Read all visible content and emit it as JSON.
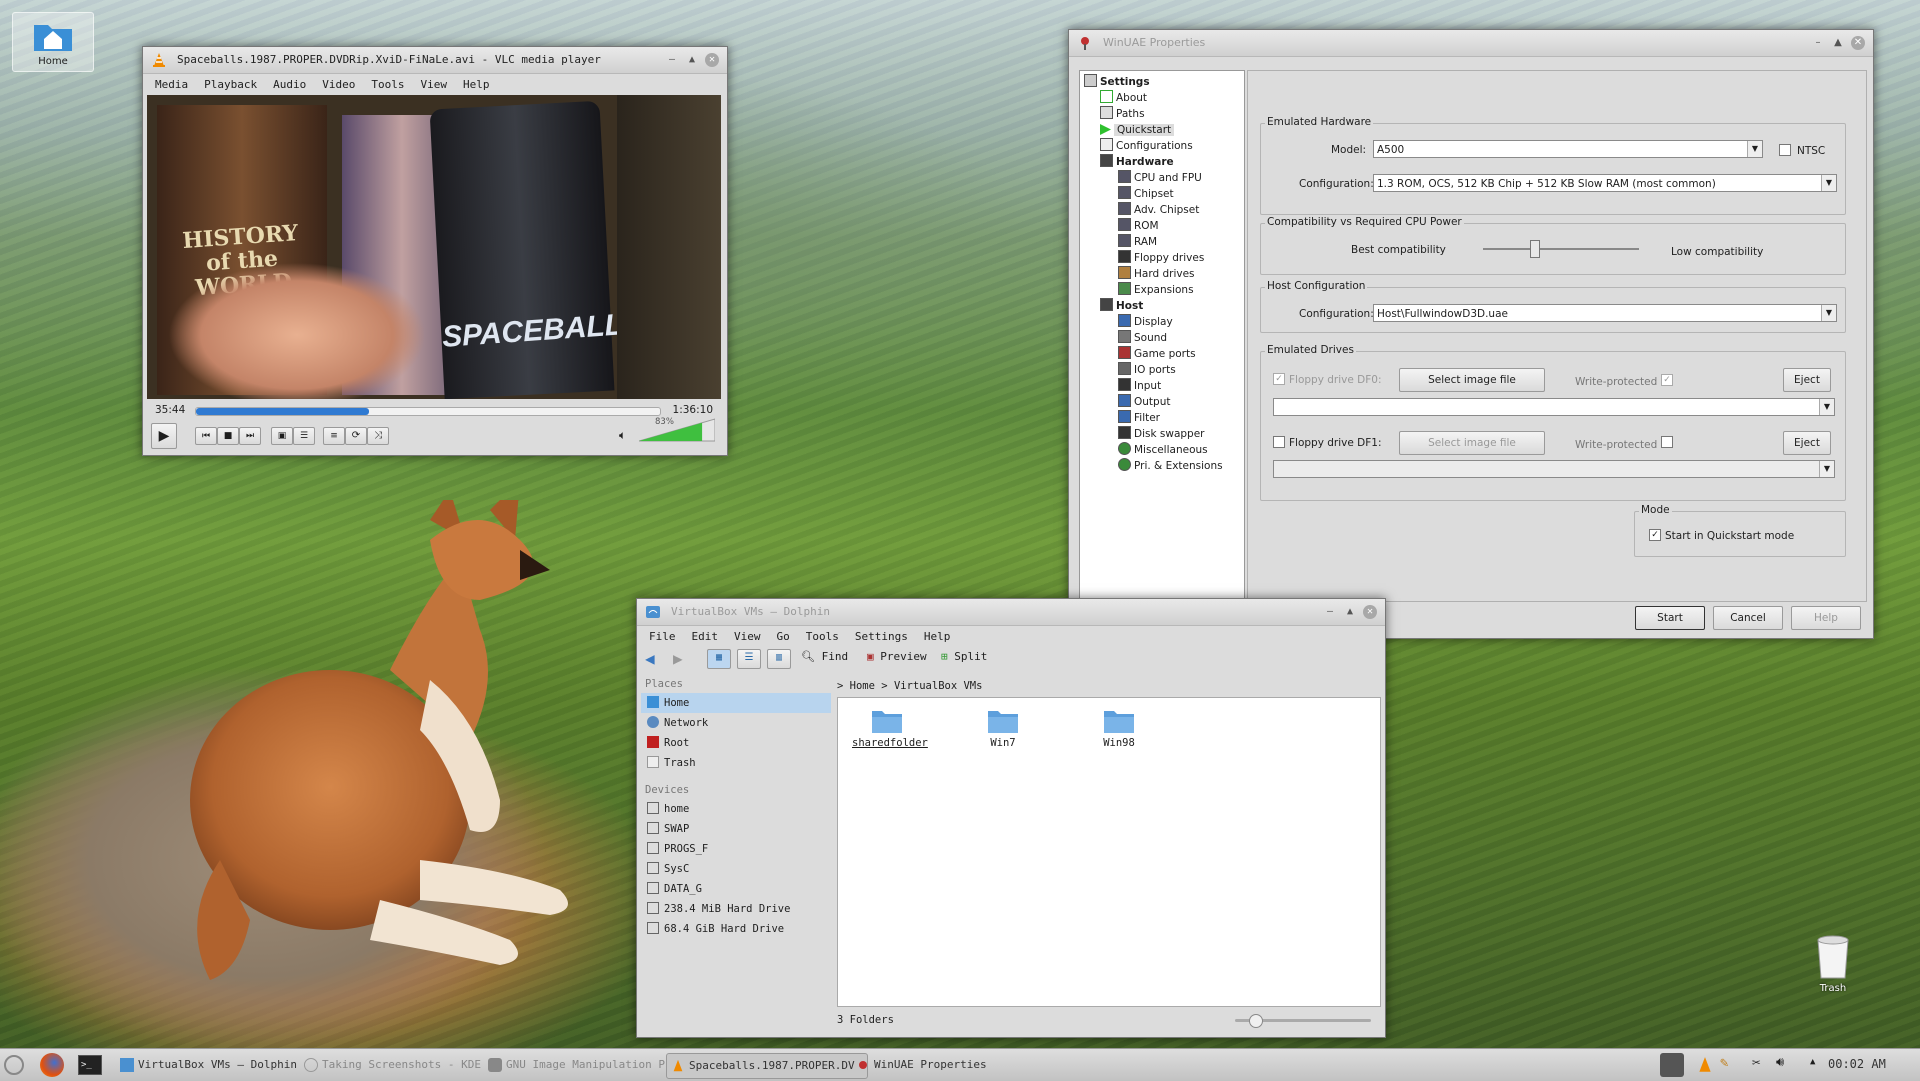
{
  "desktop": {
    "home_icon_label": "Home",
    "trash_icon_label": "Trash"
  },
  "vlc": {
    "title": "Spaceballs.1987.PROPER.DVDRip.XviD-FiNaLe.avi - VLC media player",
    "menu": [
      "Media",
      "Playback",
      "Audio",
      "Video",
      "Tools",
      "View",
      "Help"
    ],
    "elapsed": "35:44",
    "total": "1:36:10",
    "seek_fraction": 0.372,
    "volume_label": "83%",
    "volume_fraction": 0.83,
    "video_text_1": "HISTORY of the WORLD",
    "video_text_2": "SPACEBALLS"
  },
  "winuae": {
    "title": "WinUAE Properties",
    "tree": [
      {
        "label": "Settings",
        "level": 0,
        "bold": true
      },
      {
        "label": "About",
        "level": 1
      },
      {
        "label": "Paths",
        "level": 1
      },
      {
        "label": "Quickstart",
        "level": 1,
        "selected": true
      },
      {
        "label": "Configurations",
        "level": 1
      },
      {
        "label": "Hardware",
        "level": 1,
        "bold": true
      },
      {
        "label": "CPU and FPU",
        "level": 2
      },
      {
        "label": "Chipset",
        "level": 2
      },
      {
        "label": "Adv. Chipset",
        "level": 2
      },
      {
        "label": "ROM",
        "level": 2
      },
      {
        "label": "RAM",
        "level": 2
      },
      {
        "label": "Floppy drives",
        "level": 2
      },
      {
        "label": "Hard drives",
        "level": 2
      },
      {
        "label": "Expansions",
        "level": 2
      },
      {
        "label": "Host",
        "level": 1,
        "bold": true
      },
      {
        "label": "Display",
        "level": 2
      },
      {
        "label": "Sound",
        "level": 2
      },
      {
        "label": "Game ports",
        "level": 2
      },
      {
        "label": "IO ports",
        "level": 2
      },
      {
        "label": "Input",
        "level": 2
      },
      {
        "label": "Output",
        "level": 2
      },
      {
        "label": "Filter",
        "level": 2
      },
      {
        "label": "Disk swapper",
        "level": 2
      },
      {
        "label": "Miscellaneous",
        "level": 2
      },
      {
        "label": "Pri. & Extensions",
        "level": 2
      }
    ],
    "emulated_hardware": {
      "title": "Emulated Hardware",
      "model_label": "Model:",
      "model_value": "A500",
      "ntsc_label": "NTSC",
      "config_label": "Configuration:",
      "config_value": "1.3 ROM, OCS, 512 KB Chip + 512 KB Slow RAM (most common)"
    },
    "compat": {
      "title": "Compatibility vs Required CPU Power",
      "best": "Best compatibility",
      "low": "Low compatibility",
      "slider_fraction": 0.33
    },
    "host_config": {
      "title": "Host Configuration",
      "config_label": "Configuration:",
      "config_value": "Host\\FullwindowD3D.uae"
    },
    "drives": {
      "title": "Emulated Drives",
      "df0_label": "Floppy drive DF0:",
      "df1_label": "Floppy drive DF1:",
      "select_image": "Select image file",
      "write_protected": "Write-protected",
      "eject": "Eject"
    },
    "mode": {
      "title": "Mode",
      "quickstart_label": "Start in Quickstart mode"
    },
    "buttons": {
      "start": "Start",
      "cancel": "Cancel",
      "help": "Help"
    }
  },
  "dolphin": {
    "title": "VirtualBox VMs – Dolphin",
    "menu": [
      "File",
      "Edit",
      "View",
      "Go",
      "Tools",
      "Settings",
      "Help"
    ],
    "toolbar": {
      "find": "Find",
      "preview": "Preview",
      "split": "Split"
    },
    "places_header": "Places",
    "places": [
      {
        "label": "Home",
        "icon": "home-icon",
        "selected": true
      },
      {
        "label": "Network",
        "icon": "network-icon"
      },
      {
        "label": "Root",
        "icon": "root-icon"
      },
      {
        "label": "Trash",
        "icon": "trash-icon"
      }
    ],
    "devices_header": "Devices",
    "devices": [
      "home",
      "SWAP",
      "PROGS_F",
      "SysC",
      "DATA_G",
      "238.4 MiB Hard Drive",
      "68.4 GiB Hard Drive"
    ],
    "breadcrumb": [
      "Home",
      "VirtualBox VMs"
    ],
    "folders": [
      "sharedfolder",
      "Win7",
      "Win98"
    ],
    "status": "3 Folders",
    "zoom_fraction": 0.15
  },
  "taskbar": {
    "tasks": [
      {
        "label": "VirtualBox VMs – Dolphin",
        "active": false
      },
      {
        "label": "Taking Screenshots - KDE",
        "active": false
      },
      {
        "label": "GNU Image Manipulation P",
        "active": false
      },
      {
        "label": "Spaceballs.1987.PROPER.DV",
        "active": true
      },
      {
        "label": "WinUAE Properties",
        "active": false
      }
    ],
    "clock": "00:02 AM"
  }
}
